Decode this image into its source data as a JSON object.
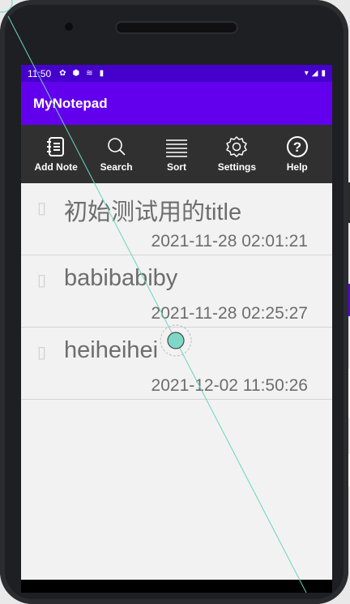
{
  "status_bar": {
    "time": "11:50"
  },
  "app_bar": {
    "title": "MyNotepad"
  },
  "toolbar": {
    "items": [
      {
        "label": "Add Note",
        "icon": "notebook-icon"
      },
      {
        "label": "Search",
        "icon": "search-icon"
      },
      {
        "label": "Sort",
        "icon": "sort-lines-icon"
      },
      {
        "label": "Settings",
        "icon": "gear-icon"
      },
      {
        "label": "Help",
        "icon": "help-icon"
      }
    ]
  },
  "notes": [
    {
      "title": "初始测试用的title",
      "date": "2021-11-28 02:01:21"
    },
    {
      "title": "babibabiby",
      "date": "2021-11-28 02:25:27"
    },
    {
      "title": "heiheihei",
      "date": "2021-12-02 11:50:26"
    }
  ],
  "colors": {
    "status_bar": "#4500cc",
    "app_bar": "#6200ee",
    "toolbar": "#303030",
    "touch_indicator": "#7fd8c7"
  }
}
